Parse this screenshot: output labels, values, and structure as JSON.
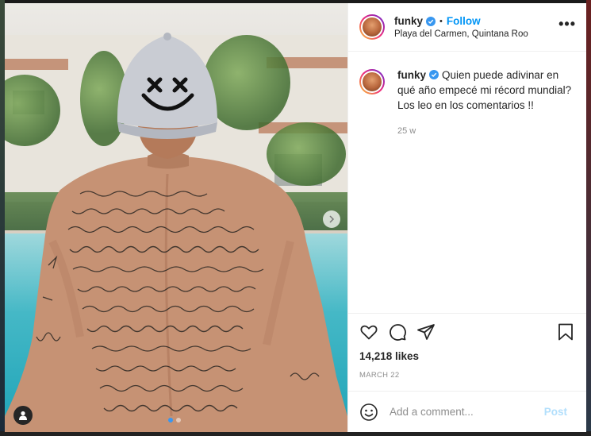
{
  "post": {
    "username": "funky",
    "follow_label": "Follow",
    "separator": "•",
    "location": "Playa del Carmen, Quintana Roo",
    "more_label": "•••",
    "caption": "Quien puede adivinar en qué año empecé mi récord mundial? Los leo en los comentarios !!",
    "time_ago": "25 w",
    "likes": "14,218 likes",
    "date": "MARCH 22"
  },
  "comment_box": {
    "placeholder": "Add a comment...",
    "post_label": "Post"
  },
  "carousel": {
    "slide_count": 2,
    "active_index": 0
  },
  "colors": {
    "accent": "#0095f6",
    "post_disabled": "#b2dffc",
    "muted": "#8e8e8e",
    "verified": "#3897f0",
    "cap": "#c9ccd3"
  },
  "icons": [
    "verified-badge-icon",
    "more-options-icon",
    "next-slide-icon",
    "user-tag-icon",
    "heart-icon",
    "comment-icon",
    "share-icon",
    "save-icon",
    "emoji-icon"
  ]
}
